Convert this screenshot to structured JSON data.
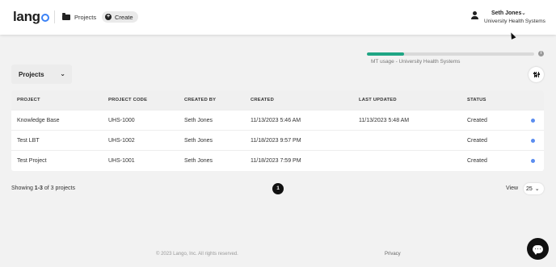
{
  "header": {
    "logo_text": "lang",
    "nav_projects": "Projects",
    "create_label": "Create",
    "user_name": "Seth Jones",
    "org_name": "University Health Systems"
  },
  "usage": {
    "label": "MT usage - University Health Systems",
    "fill_fraction": 0.22,
    "info_glyph": "i",
    "bar_color": "#1fa584"
  },
  "toolbar": {
    "projects_select": "Projects"
  },
  "table": {
    "headers": [
      "PROJECT",
      "PROJECT CODE",
      "CREATED BY",
      "CREATED",
      "LAST UPDATED",
      "STATUS"
    ],
    "rows": [
      {
        "project": "Knowledge Base",
        "code": "UHS-1000",
        "created_by": "Seth Jones",
        "created": "11/13/2023 5:46 AM",
        "last_updated": "11/13/2023 5:48 AM",
        "status": "Created"
      },
      {
        "project": "Test LBT",
        "code": "UHS-1002",
        "created_by": "Seth Jones",
        "created": "11/18/2023 9:57 PM",
        "last_updated": "",
        "status": "Created"
      },
      {
        "project": "Test Project",
        "code": "UHS-1001",
        "created_by": "Seth Jones",
        "created": "11/18/2023 7:59 PM",
        "last_updated": "",
        "status": "Created"
      }
    ],
    "status_dot_color": "#5b8def"
  },
  "pagination": {
    "showing_prefix": "Showing ",
    "showing_range": "1-3",
    "showing_suffix": " of 3 projects",
    "current_page": "1",
    "view_label": "View",
    "view_value": "25"
  },
  "footer": {
    "copyright": "© 2023 Lango, Inc. All rights reserved.",
    "privacy": "Privacy"
  },
  "icons": [
    "folder-icon",
    "plus-circle-icon",
    "user-icon",
    "chevron-down-icon",
    "info-icon",
    "filter-icon",
    "chat-icon"
  ]
}
